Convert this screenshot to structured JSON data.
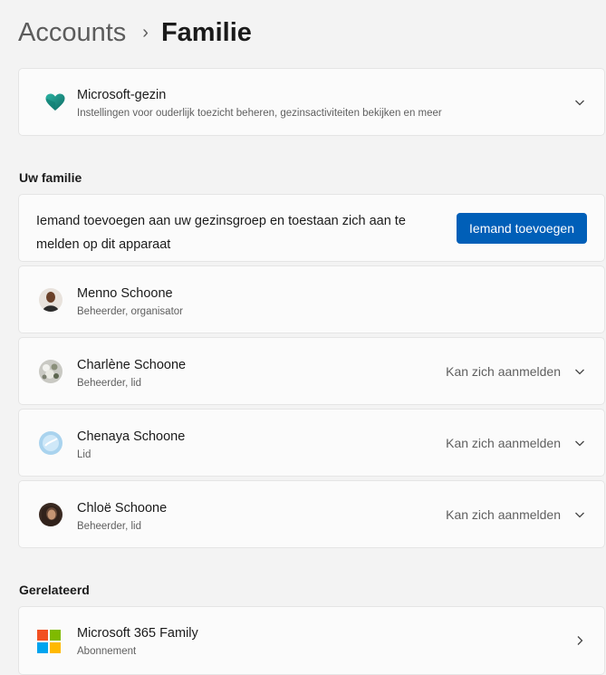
{
  "breadcrumb": {
    "parent": "Accounts",
    "separator": "›",
    "current": "Familie"
  },
  "microsoft_family": {
    "title": "Microsoft-gezin",
    "subtitle": "Instellingen voor ouderlijk toezicht beheren, gezinsactiviteiten bekijken en meer",
    "icon": "heart-icon"
  },
  "your_family": {
    "heading": "Uw familie",
    "add_text": "Iemand toevoegen aan uw gezinsgroep en toestaan zich aan te melden op dit  apparaat",
    "add_button": "Iemand toevoegen",
    "members": [
      {
        "name": "Menno Schoone",
        "role": "Beheerder, organisator",
        "status": ""
      },
      {
        "name": "Charlène Schoone",
        "role": "Beheerder, lid",
        "status": "Kan zich aanmelden"
      },
      {
        "name": "Chenaya Schoone",
        "role": "Lid",
        "status": "Kan zich aanmelden"
      },
      {
        "name": "Chloë Schoone",
        "role": "Beheerder, lid",
        "status": "Kan zich aanmelden"
      }
    ]
  },
  "related": {
    "heading": "Gerelateerd",
    "items": [
      {
        "title": "Microsoft 365 Family",
        "subtitle": "Abonnement",
        "icon": "microsoft-logo-icon"
      }
    ]
  },
  "colors": {
    "accent": "#005fb8",
    "background": "#f3f3f3",
    "card": "#fbfbfb",
    "heart": "#1a8c80"
  }
}
